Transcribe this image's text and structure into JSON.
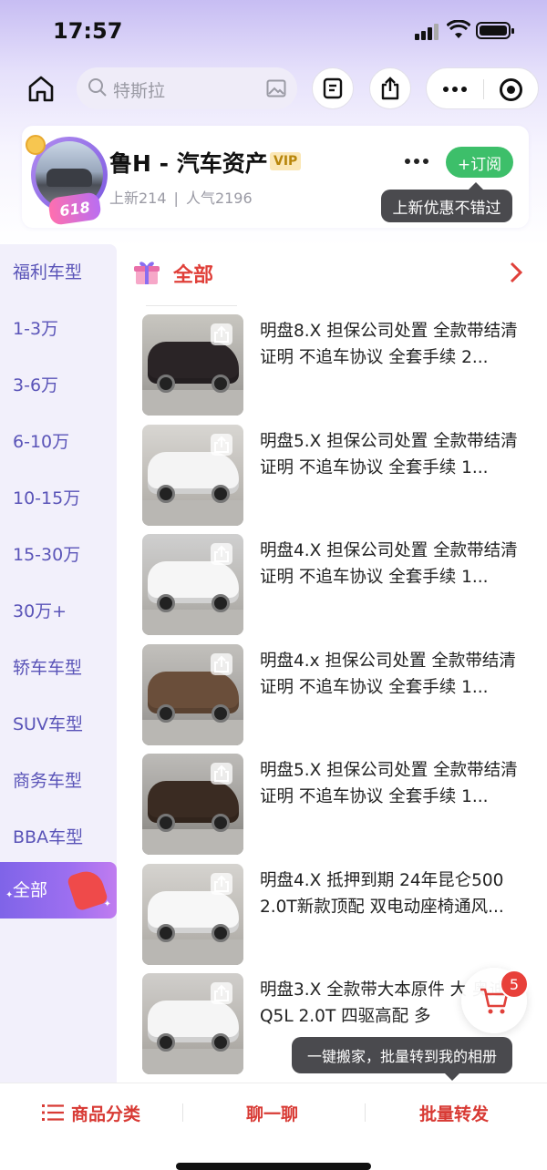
{
  "status_bar": {
    "time": "17:57"
  },
  "nav": {
    "search_placeholder": "特斯拉"
  },
  "store": {
    "name": "鲁H - 汽车资产",
    "vip_label": "VIP",
    "new_label": "上新214",
    "popularity_label": "人气2196",
    "subscribe_label": "+订阅",
    "badge_text": "618",
    "tooltip": "上新优惠不错过"
  },
  "sidebar": {
    "items": [
      {
        "label": "福利车型"
      },
      {
        "label": "1-3万"
      },
      {
        "label": "3-6万"
      },
      {
        "label": "6-10万"
      },
      {
        "label": "10-15万"
      },
      {
        "label": "15-30万"
      },
      {
        "label": "30万+"
      },
      {
        "label": "轿车车型"
      },
      {
        "label": "SUV车型"
      },
      {
        "label": "商务车型"
      },
      {
        "label": "BBA车型"
      },
      {
        "label": "全部",
        "active": true
      }
    ]
  },
  "section": {
    "title": "全部"
  },
  "products": [
    {
      "title": "明盘8.X 担保公司处置 全款带结清证明 不追车协议 全套手续 2...",
      "car_color": "#2a2426"
    },
    {
      "title": "明盘5.X 担保公司处置 全款带结清证明 不追车协议 全套手续 1...",
      "car_color": "#f4f4f4"
    },
    {
      "title": "明盘4.X 担保公司处置 全款带结清证明 不追车协议 全套手续 1...",
      "car_color": "#f6f6f6"
    },
    {
      "title": "明盘4.x 担保公司处置 全款带结清证明 不追车协议 全套手续 1...",
      "car_color": "#6a4e3a"
    },
    {
      "title": "明盘5.X 担保公司处置 全款带结清证明 不追车协议 全套手续 1...",
      "car_color": "#3a2b22"
    },
    {
      "title": "明盘4.X 抵押到期 24年昆仑500 2.0T新款顶配 双电动座椅通风...",
      "car_color": "#f7f7f7"
    },
    {
      "title": "明盘3.X 全款带大本原件 大 奥迪Q5L 2.0T 四驱高配 多",
      "car_color": "#f5f5f5"
    }
  ],
  "cart": {
    "count": "5"
  },
  "batch_tooltip": "一键搬家，批量转到我的相册",
  "bottom_bar": {
    "category_label": "商品分类",
    "chat_label": "聊一聊",
    "forward_label": "批量转发"
  },
  "colors": {
    "accent_purple": "#7f64e8",
    "accent_red": "#e0403a",
    "subscribe_green": "#3dbf6a"
  }
}
